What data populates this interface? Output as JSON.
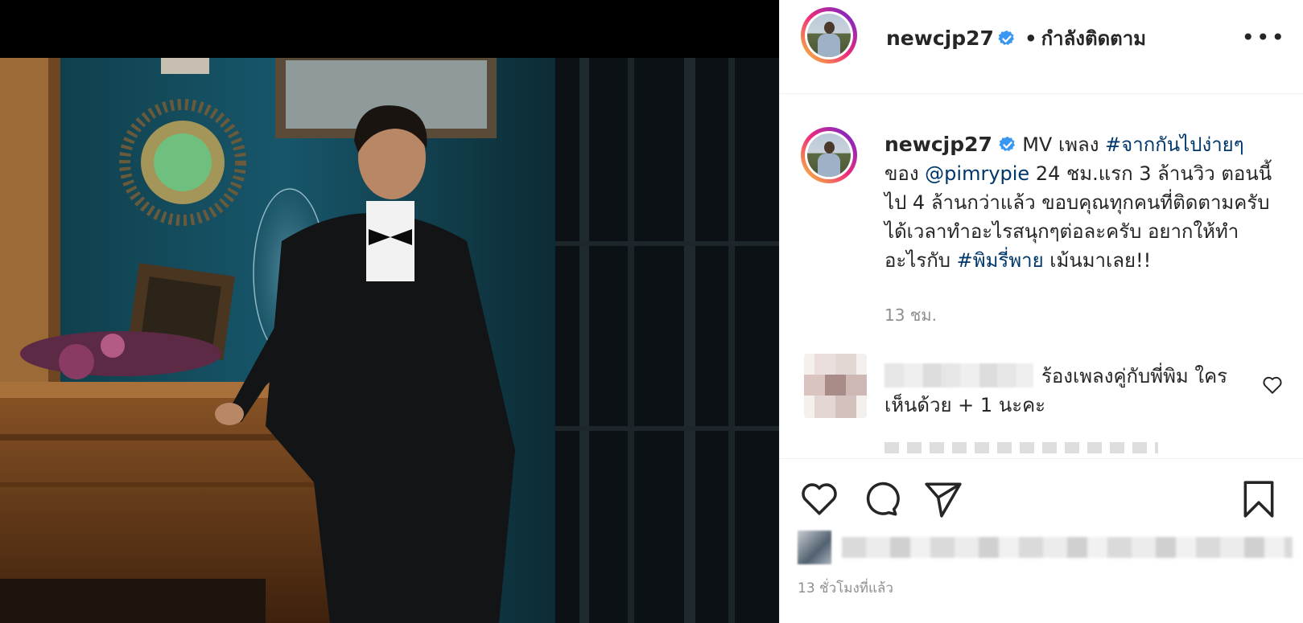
{
  "header": {
    "username": "newcjp27",
    "separator": "•",
    "follow_status": "กำลังติดตาม",
    "more_label": "•••"
  },
  "caption": {
    "username": "newcjp27",
    "text_part1": " MV เพลง ",
    "hashtag1": "#จากกันไปง่ายๆ",
    "text_part2": " ของ ",
    "mention": "@pimrypie",
    "text_part3": " 24 ชม.แรก 3 ล้านวิว ตอนนี้ไป 4 ล้านกว่าแล้ว ขอบคุณทุกคนที่ติดตามครับ ได้เวลาทำอะไรสนุกๆต่อละครับ อยากให้ทำอะไรกับ ",
    "hashtag2": "#พิมรี่พาย",
    "text_part4": " เม้นมาเลย!!",
    "time": "13 ชม."
  },
  "comment": {
    "text": "ร้องเพลงคู่กับพี่พิม ใครเห็นด้วย + 1 นะคะ"
  },
  "footer": {
    "post_time": "13 ชั่วโมงที่แล้ว"
  },
  "colors": {
    "link": "#00376b",
    "verified": "#3897f0",
    "muted": "#8e8e8e",
    "divider": "#efefef"
  },
  "icons": [
    "verified-badge-icon",
    "more-options-icon",
    "like-heart-icon",
    "comment-bubble-icon",
    "share-paper-plane-icon",
    "save-bookmark-icon",
    "comment-like-icon"
  ]
}
